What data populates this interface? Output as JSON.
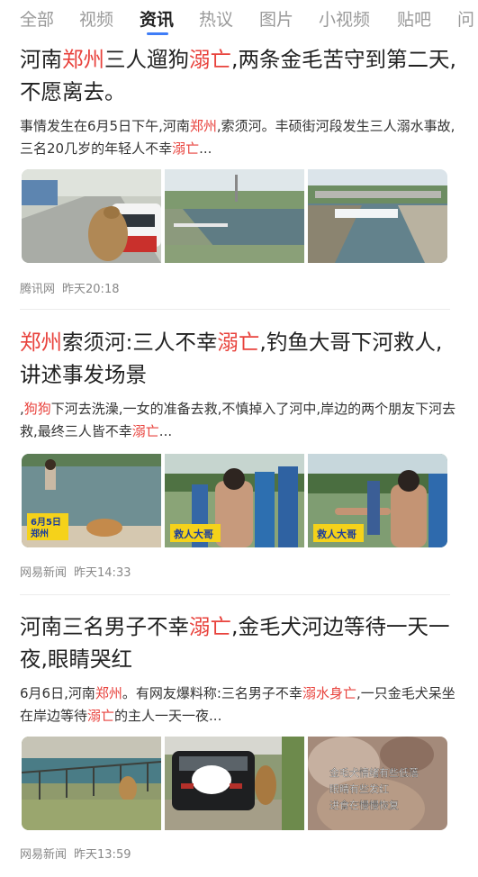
{
  "tabs": [
    "全部",
    "视频",
    "资讯",
    "热议",
    "图片",
    "小视频",
    "贴吧",
    "问"
  ],
  "active_tab": "资讯",
  "highlight_color": "#e8423c",
  "accent_color": "#3f7df7",
  "articles": [
    {
      "title": [
        {
          "t": "河南",
          "h": false
        },
        {
          "t": "郑州",
          "h": true
        },
        {
          "t": "三人遛狗",
          "h": false
        },
        {
          "t": "溺亡",
          "h": true
        },
        {
          "t": ",两条金毛苦守到第二天,不愿离去。",
          "h": false
        }
      ],
      "summary": [
        {
          "t": "事情发生在6月5日下午,河南",
          "h": false
        },
        {
          "t": "郑州",
          "h": true
        },
        {
          "t": ",索须河。丰硕街河段发生三人溺水事故,三名20几岁的年轻人不幸",
          "h": false
        },
        {
          "t": "溺亡",
          "h": true
        },
        {
          "t": "...",
          "h": false
        }
      ],
      "source": "腾讯网",
      "time": "昨天20:18",
      "images": [
        {
          "subject": "road-dog-car",
          "captions": []
        },
        {
          "subject": "river-park",
          "captions": []
        },
        {
          "subject": "river-weir",
          "captions": []
        }
      ]
    },
    {
      "title": [
        {
          "t": "郑州",
          "h": true
        },
        {
          "t": "索须河:三人不幸",
          "h": false
        },
        {
          "t": "溺亡",
          "h": true
        },
        {
          "t": ",钓鱼大哥下河救人,讲述事发场景",
          "h": false
        }
      ],
      "summary": [
        {
          "t": ",",
          "h": false
        },
        {
          "t": "狗狗",
          "h": true
        },
        {
          "t": "下河去洗澡,一女的准备去救,不慎掉入了河中,岸边的两个朋友下河去救,最终三人皆不幸",
          "h": false
        },
        {
          "t": "溺亡",
          "h": true
        },
        {
          "t": "...",
          "h": false
        }
      ],
      "source": "网易新闻",
      "time": "昨天14:33",
      "images": [
        {
          "subject": "river-dog",
          "captions": [
            "6月5日",
            "郑州"
          ]
        },
        {
          "subject": "rescuer-crowd",
          "captions": [
            "救人大哥"
          ]
        },
        {
          "subject": "rescuer-pointing",
          "captions": [
            "救人大哥"
          ]
        }
      ]
    },
    {
      "title": [
        {
          "t": "河南三名男子不幸",
          "h": false
        },
        {
          "t": "溺亡",
          "h": true
        },
        {
          "t": ",金毛犬河边等待一天一夜,眼睛哭红",
          "h": false
        }
      ],
      "summary": [
        {
          "t": "6月6日,河南",
          "h": false
        },
        {
          "t": "郑州",
          "h": true
        },
        {
          "t": "。有网友爆料称:三名男子不幸",
          "h": false
        },
        {
          "t": "溺水身亡",
          "h": true
        },
        {
          "t": ",一只金毛犬呆坐在岸边等待",
          "h": false
        },
        {
          "t": "溺亡",
          "h": true
        },
        {
          "t": "的主人一天一夜...",
          "h": false
        }
      ],
      "source": "网易新闻",
      "time": "昨天13:59",
      "images": [
        {
          "subject": "riverbank-dog",
          "captions": []
        },
        {
          "subject": "black-car-dog",
          "captions": []
        },
        {
          "subject": "dog-closeup",
          "captions": [
            "金毛犬情绪有些低落",
            "眼睛有些发红",
            "进食在慢慢恢复"
          ]
        }
      ]
    }
  ]
}
